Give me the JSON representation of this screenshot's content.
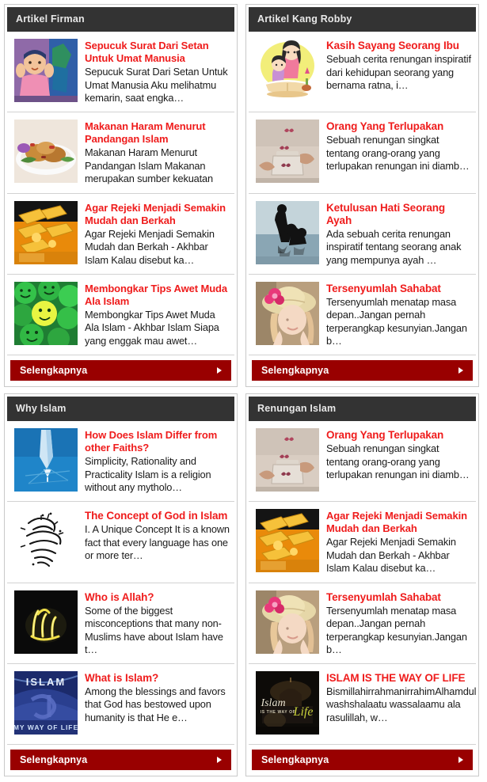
{
  "colors": {
    "header_bg": "#333333",
    "header_text": "#e8e8e8",
    "title_link": "#ef1c1c",
    "more_bg": "#990000",
    "more_text": "#ffffff",
    "panel_border": "#c9c9c9",
    "item_divider": "#d2d2d2",
    "body_text": "#1a1a1a"
  },
  "panels": [
    {
      "header": "Artikel Firman",
      "more_label": "Selengkapnya",
      "more_arrow_icon": "triangle-right-icon",
      "items": [
        {
          "title": "Sepucuk Surat Dari Setan Untuk Umat Manusia",
          "excerpt": "Sepucuk Surat Dari Setan Untuk Umat Manusia Aku melihatmu kemarin, saat engka…",
          "thumb_name": "thumb-boy-illustration"
        },
        {
          "title": "Makanan Haram Menurut Pandangan Islam",
          "excerpt": "Makanan Haram Menurut Pandangan Islam Makanan merupakan sumber kekuatan",
          "thumb_name": "thumb-food-plate"
        },
        {
          "title": "Agar Rejeki Menjadi Semakin Mudah dan Berkah",
          "excerpt": "Agar Rejeki Menjadi Semakin Mudah dan Berkah - Akhbar Islam Kalau disebut ka…",
          "thumb_name": "thumb-gold-bars"
        },
        {
          "title": "Membongkar Tips Awet Muda Ala Islam",
          "excerpt": "Membongkar Tips Awet Muda Ala Islam - Akhbar Islam Siapa yang enggak mau awet…",
          "thumb_name": "thumb-green-smileys"
        }
      ]
    },
    {
      "header": "Artikel Kang Robby",
      "more_label": "Selengkapnya",
      "more_arrow_icon": "triangle-right-icon",
      "items": [
        {
          "title": "Kasih Sayang Seorang Ibu",
          "excerpt": "Sebuah cerita renungan inspiratif dari kehidupan seorang yang bernama ratna, i…",
          "thumb_name": "thumb-mother-child-cartoon"
        },
        {
          "title": "Orang Yang Terlupakan",
          "excerpt": "Sebuah renungan singkat tentang orang-orang yang terlupakan renungan ini diamb…",
          "thumb_name": "thumb-butterfly-jar"
        },
        {
          "title": "Ketulusan Hati Seorang Ayah",
          "excerpt": "Ada sebuah cerita renungan inspiratif tentang seorang anak yang mempunya ayah …",
          "thumb_name": "thumb-father-child-water"
        },
        {
          "title": "Tersenyumlah Sahabat",
          "excerpt": "Tersenyumlah menatap masa depan..Jangan pernah terperangkap kesunyian.Jangan b…",
          "thumb_name": "thumb-girl-hat"
        }
      ]
    },
    {
      "header": "Why Islam",
      "more_label": "Selengkapnya",
      "more_arrow_icon": "triangle-right-icon",
      "items": [
        {
          "title": "How Does Islam Differ from other Faiths?",
          "excerpt": "Simplicity, Rationality and Practicality Islam is a religion without any mytholo…",
          "thumb_name": "thumb-blue-pen"
        },
        {
          "title": "The Concept of God in Islam",
          "excerpt": "I. A Unique Concept It is a known fact that every language has one or more ter…",
          "thumb_name": "thumb-arabic-calligraphy-white"
        },
        {
          "title": "Who is Allah?",
          "excerpt": "Some of the biggest misconceptions that many non-Muslims have about Islam have t…",
          "thumb_name": "thumb-allah-gold-black"
        },
        {
          "title": "What is Islam?",
          "excerpt": " Among the blessings and favors that God has bestowed upon humanity is that He e…",
          "thumb_name": "thumb-islam-my-way-of-life"
        }
      ]
    },
    {
      "header": "Renungan Islam",
      "more_label": "Selengkapnya",
      "more_arrow_icon": "triangle-right-icon",
      "items": [
        {
          "title": "Orang Yang Terlupakan",
          "excerpt": "Sebuah renungan singkat tentang orang-orang yang terlupakan renungan ini diamb…",
          "thumb_name": "thumb-butterfly-jar"
        },
        {
          "title": "Agar Rejeki Menjadi Semakin Mudah dan Berkah",
          "excerpt": "Agar Rejeki Menjadi Semakin Mudah dan Berkah - Akhbar Islam Kalau disebut ka…",
          "thumb_name": "thumb-gold-bars"
        },
        {
          "title": "Tersenyumlah Sahabat",
          "excerpt": "Tersenyumlah menatap masa depan..Jangan pernah terperangkap kesunyian.Jangan b…",
          "thumb_name": "thumb-girl-hat"
        },
        {
          "title": "ISLAM IS THE WAY OF LIFE",
          "excerpt": "BismillahirrahmanirrahimAlhamdulillah, washshalaatu wassalaamu ala rasulillah, w…",
          "thumb_name": "thumb-islam-way-of-life-dark"
        }
      ]
    }
  ]
}
